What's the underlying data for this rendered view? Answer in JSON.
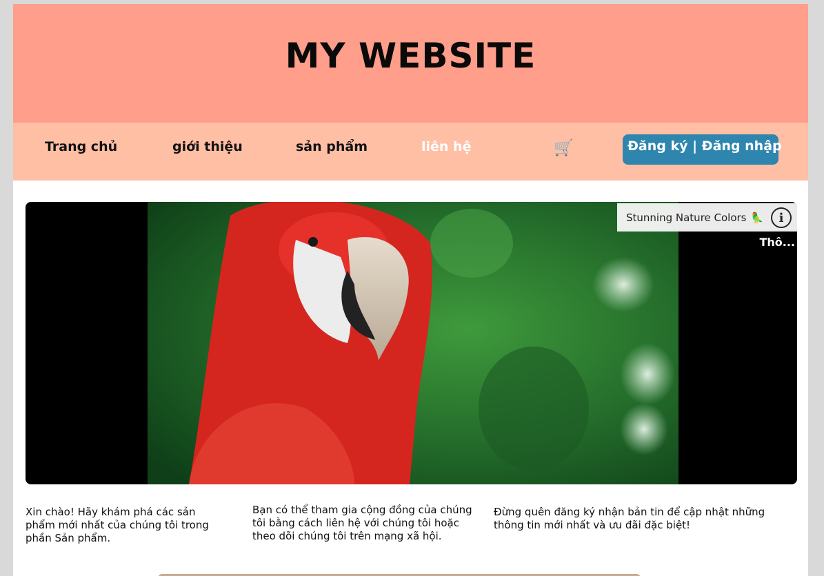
{
  "header": {
    "title": "MY WEBSITE"
  },
  "nav": {
    "items": [
      {
        "label": "Trang chủ"
      },
      {
        "label": "giới thiệu"
      },
      {
        "label": "sản phẩm"
      },
      {
        "label": "liên hệ"
      }
    ],
    "cart_icon": "cart-icon",
    "auth_label": "Đăng ký | Đăng nhập",
    "colors": {
      "header_bg": "#ff9e8a",
      "nav_bg": "#ffbfa4",
      "auth_button": "#2e86ae",
      "active_item": "#ffffff"
    }
  },
  "video": {
    "title": "Stunning Nature Colors",
    "title_emoji": "🦜",
    "info_icon": "info-icon",
    "info_symbol": "i",
    "overlay_text": "Thô..."
  },
  "content": {
    "columns": [
      {
        "text": "Xin chào! Hãy khám phá các sản phẩm mới nhất của chúng tôi trong phần Sản phẩm."
      },
      {
        "text": "Bạn có thể tham gia cộng đồng của chúng tôi bằng cách liên hệ với chúng tôi hoặc theo dõi chúng tôi trên mạng xã hội."
      },
      {
        "text": "Đừng quên đăng ký nhận bản tin để cập nhật những thông tin mới nhất và ưu đãi đặc biệt!"
      }
    ]
  }
}
